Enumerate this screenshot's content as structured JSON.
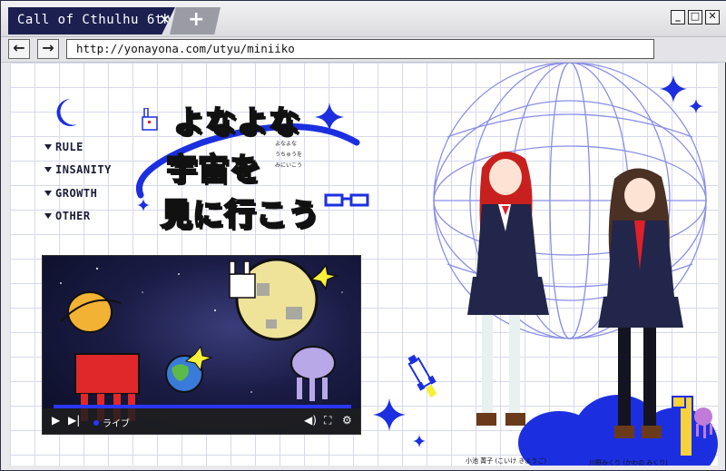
{
  "browser": {
    "tab_title": "Call of Cthulhu 6th",
    "tab_close": "✕",
    "new_tab": "+",
    "url": "http://yonayona.com/utyu/miniiko",
    "back": "←",
    "forward": "→",
    "minimize": "_",
    "maximize": "□",
    "close": "✕"
  },
  "menu": {
    "items": [
      {
        "label": "RULE"
      },
      {
        "label": "INSANITY"
      },
      {
        "label": "GROWTH"
      },
      {
        "label": "OTHER"
      }
    ]
  },
  "logo": {
    "line1": "よなよな",
    "line2": "宇宙を",
    "line3": "見に行こう",
    "ruby": [
      "よなよな",
      "うちゅうを",
      "みにいこう"
    ]
  },
  "video": {
    "live_label": "ライブ"
  },
  "characters": [
    {
      "caption": "小池 菁子 (こいけ きようご)"
    },
    {
      "caption": "川野みくり (かわの みくり)"
    }
  ],
  "colors": {
    "accent_blue": "#1c2fe0",
    "tab_dark": "#1c2050",
    "globe_lines": "#8a8ee6"
  }
}
